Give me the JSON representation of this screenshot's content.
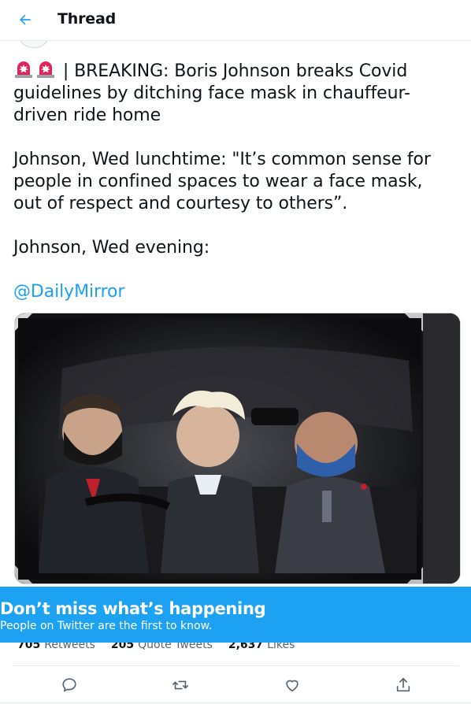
{
  "header": {
    "title": "Thread"
  },
  "tweet": {
    "line1": "| BREAKING: Boris Johnson breaks Covid guidelines by ditching face mask in chauffeur-driven ride home",
    "para2": "Johnson, Wed lunchtime: \"It’s common sense for people in confined spaces to wear a face mask, out of respect and courtesy to others”.",
    "para3": "Johnson, Wed evening:",
    "mention": "@DailyMirror",
    "emoji": "rotating-light-emoji"
  },
  "media": {
    "icon": "photo",
    "alt_visible": ""
  },
  "stats": {
    "retweets_count": "705",
    "retweets_label": "Retweets",
    "quotes_count": "205",
    "quotes_label": "Quote Tweets",
    "likes_count": "2,637",
    "likes_label": "Likes"
  },
  "banner": {
    "title": "Don’t miss what’s happening",
    "subtitle": "People on Twitter are the first to know."
  },
  "colors": {
    "accent": "#1da1f2",
    "text": "#0f1419",
    "muted": "#536471"
  },
  "actions": [
    "reply-icon",
    "retweet-icon",
    "like-icon",
    "share-icon"
  ]
}
